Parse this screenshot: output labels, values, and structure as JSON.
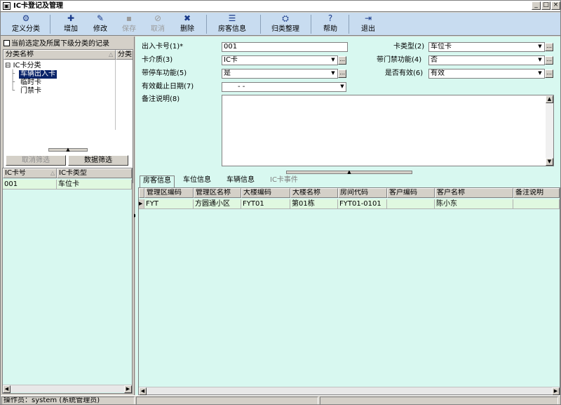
{
  "window": {
    "title": "IC卡登记及管理",
    "min_btn": "_",
    "max_btn": "□",
    "close_btn": "×"
  },
  "toolbar": {
    "define_category": {
      "label": "定义分类",
      "icon": "category-icon"
    },
    "add": {
      "label": "增加",
      "icon": "add-icon"
    },
    "edit": {
      "label": "修改",
      "icon": "edit-icon"
    },
    "save": {
      "label": "保存",
      "icon": "save-icon"
    },
    "cancel": {
      "label": "取消",
      "icon": "cancel-icon"
    },
    "delete": {
      "label": "删除",
      "icon": "delete-icon"
    },
    "house_info": {
      "label": "房客信息",
      "icon": "list-icon"
    },
    "organize": {
      "label": "归类整理",
      "icon": "organize-icon"
    },
    "help": {
      "label": "帮助",
      "icon": "help-icon"
    },
    "exit": {
      "label": "退出",
      "icon": "exit-icon"
    }
  },
  "left": {
    "checkbox_label": "当前选定及所属下级分类的记录",
    "tree_header_name": "分类名称",
    "tree_header_2": "分类",
    "tree_root": "IC卡分类",
    "tree_items": [
      "车辆出入卡",
      "临时卡",
      "门禁卡"
    ],
    "cancel_filter": "取消筛选",
    "data_filter": "数据筛选",
    "list_header_no": "IC卡号",
    "list_header_type": "IC卡类型",
    "list_rows": [
      {
        "no": "001",
        "type": "车位卡"
      }
    ]
  },
  "form": {
    "card_no_label": "出入卡号(1)*",
    "card_no_value": "001",
    "card_type_label": "卡类型(2)",
    "card_type_value": "车位卡",
    "card_medium_label": "卡介质(3)",
    "card_medium_value": "IC卡",
    "door_func_label": "带门禁功能(4)",
    "door_func_value": "否",
    "parking_func_label": "带停车功能(5)",
    "parking_func_value": "是",
    "valid_label": "是否有效(6)",
    "valid_value": "有效",
    "expire_label": "有效截止日期(7)",
    "expire_value": "-  -",
    "note_label": "备注说明(8)",
    "dots": "…",
    "dropdown": "▼"
  },
  "tabs": [
    "房客信息",
    "车位信息",
    "车辆信息",
    "IC卡事件"
  ],
  "grid": {
    "columns": [
      "管理区编码",
      "管理区名称",
      "大楼编码",
      "大楼名称",
      "房间代码",
      "客户编码",
      "客户名称",
      "备注说明"
    ],
    "rows": [
      [
        "FYT",
        "方圆通小区",
        "FYT01",
        "第01栋",
        "FYT01-0101",
        "",
        "陈小东",
        ""
      ]
    ]
  },
  "status": {
    "operator": "操作员：system (系统管理员)"
  }
}
